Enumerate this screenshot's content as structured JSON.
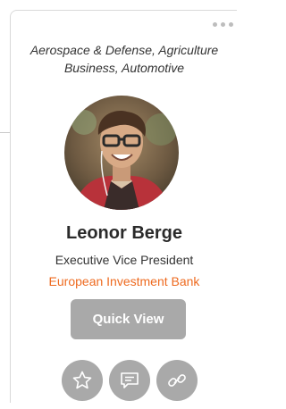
{
  "card": {
    "industries": "Aerospace & Defense, Agriculture Business, Automotive",
    "name": "Leonor Berge",
    "title": "Executive Vice President",
    "company": "European Investment Bank",
    "quick_view_label": "Quick View",
    "more_menu_icon": "ellipsis-horizontal-icon",
    "actions": [
      {
        "icon": "star-icon"
      },
      {
        "icon": "message-icon"
      },
      {
        "icon": "link-icon"
      }
    ]
  },
  "colors": {
    "company_accent": "#ee6a1f",
    "button_gray": "#a9a9a9",
    "text_dark": "#2a2a2a"
  }
}
